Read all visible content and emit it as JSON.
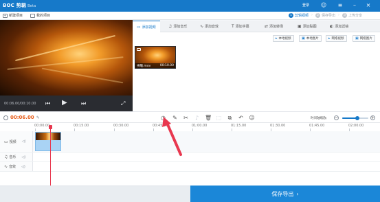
{
  "app": {
    "title": "BOC 剪辑",
    "beta": "Beta",
    "login": "登录"
  },
  "steps": [
    {
      "num": "1",
      "label": "剪辑视频",
      "active": true
    },
    {
      "num": "2",
      "label": "保存导出",
      "active": false
    },
    {
      "num": "3",
      "label": "上传分享",
      "active": false
    }
  ],
  "menu": {
    "new_project": "新建项目",
    "my_projects": "我的项目"
  },
  "preview": {
    "timecode": "00:06.00/00:10.00"
  },
  "tabs": [
    {
      "label": "添加视频",
      "icon": "video-icon",
      "glyph": "▭",
      "active": true
    },
    {
      "label": "添加音乐",
      "icon": "music-icon",
      "glyph": "♫",
      "active": false
    },
    {
      "label": "添加音效",
      "icon": "sound-effect-icon",
      "glyph": "∿",
      "active": false
    },
    {
      "label": "添加字幕",
      "icon": "text-icon",
      "glyph": "T",
      "active": false
    },
    {
      "label": "添加转场",
      "icon": "transition-icon",
      "glyph": "⇄",
      "active": false
    },
    {
      "label": "添加贴图",
      "icon": "sticker-icon",
      "glyph": "▣",
      "active": false
    },
    {
      "label": "添加滤镜",
      "icon": "filter-icon",
      "glyph": "◐",
      "active": false
    }
  ],
  "import_buttons": [
    {
      "label": "本地视频",
      "icon": "local-video-icon"
    },
    {
      "label": "本地图片",
      "icon": "local-image-icon"
    },
    {
      "label": "网络视频",
      "icon": "web-video-icon"
    },
    {
      "label": "网络图片",
      "icon": "web-image-icon"
    }
  ],
  "clip": {
    "name": "拼雕.mov",
    "duration": "00:10.00"
  },
  "toolbar": {
    "current_time": "00:06.00",
    "zoom_label": "时间轴缩放："
  },
  "ruler": [
    "00:00.00",
    "00:15.00",
    "00:30.00",
    "00:45.00",
    "01:00.00",
    "01:15.00",
    "01:30.00",
    "01:45.00",
    "02:00.00"
  ],
  "tracks": [
    {
      "label": "视频",
      "icon": "film-icon"
    },
    {
      "label": "音乐",
      "icon": "music-note-icon"
    },
    {
      "label": "音效",
      "icon": "sound-icon"
    }
  ],
  "export": {
    "label": "保存导出",
    "arrow": "›"
  },
  "colors": {
    "brand": "#1679c9",
    "playhead": "#e8384f",
    "time": "#e85d1a",
    "annotation": "#e8384f"
  }
}
